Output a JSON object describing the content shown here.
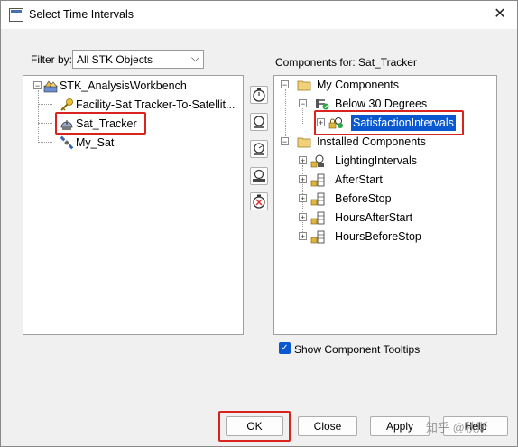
{
  "window": {
    "title": "Select Time Intervals",
    "close_glyph": "✕"
  },
  "filter": {
    "label": "Filter by:",
    "value": "All STK Objects"
  },
  "components_label": "Components for: Sat_Tracker",
  "left_tree": {
    "root": "STK_AnalysisWorkbench",
    "items": [
      "Facility-Sat Tracker-To-Satellit...",
      "Sat_Tracker",
      "My_Sat"
    ]
  },
  "right_tree": {
    "my_components": "My Components",
    "below": "Below 30 Degrees",
    "satisfaction": "SatisfactionIntervals",
    "installed": "Installed Components",
    "installed_items": [
      "LightingIntervals",
      "AfterStart",
      "BeforeStop",
      "HoursAfterStart",
      "HoursBeforeStop"
    ]
  },
  "tooltips_checkbox": {
    "label": "Show Component Tooltips",
    "checked": true
  },
  "buttons": {
    "ok": "OK",
    "close": "Close",
    "apply": "Apply",
    "help": "Help"
  },
  "watermark": "知乎 @秋斯",
  "colors": {
    "selection": "#0a58d0",
    "highlight": "#d9231f"
  }
}
